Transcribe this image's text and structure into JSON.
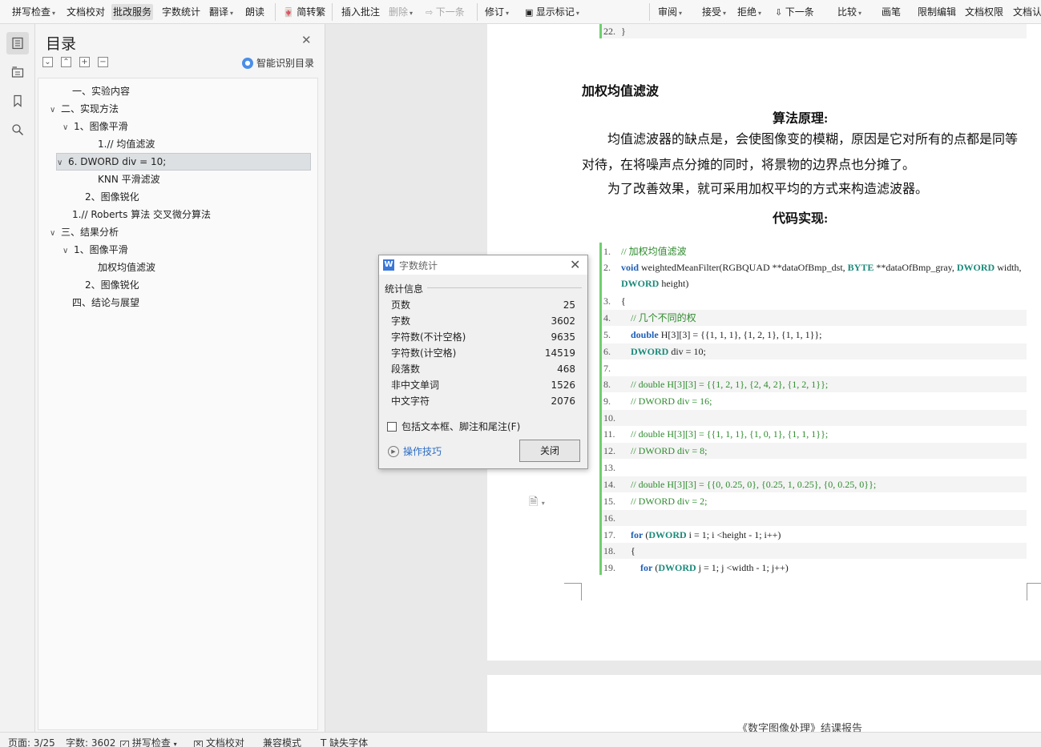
{
  "ribbon": {
    "items": [
      {
        "label": "拼写检查",
        "caret": true
      },
      {
        "label": "文档校对",
        "caret": false
      },
      {
        "label": "批改服务",
        "caret": false,
        "active": true
      },
      {
        "label": "字数统计",
        "caret": false
      },
      {
        "label": "翻译",
        "caret": true
      },
      {
        "label": "朗读",
        "caret": false
      },
      {
        "label": "简转繁",
        "caret": false
      },
      {
        "label": "插入批注",
        "caret": false
      },
      {
        "label": "删除",
        "caret": true,
        "disabled": true
      },
      {
        "label": "下一条",
        "caret": false,
        "disabled": true
      },
      {
        "label": "修订",
        "caret": true
      },
      {
        "label": "显示标记",
        "caret": true
      },
      {
        "label": "审阅",
        "caret": true
      },
      {
        "label": "接受",
        "caret": true
      },
      {
        "label": "拒绝",
        "caret": true
      },
      {
        "label": "下一条",
        "caret": false
      },
      {
        "label": "比较",
        "caret": true
      },
      {
        "label": "画笔",
        "caret": false
      },
      {
        "label": "限制编辑",
        "caret": false
      },
      {
        "label": "文档权限",
        "caret": false
      },
      {
        "label": "文档认证",
        "caret": false
      }
    ]
  },
  "iconbar": {
    "icons": [
      "toc-icon",
      "outline-icon",
      "bookmark-icon",
      "search-icon"
    ]
  },
  "toc": {
    "title": "目录",
    "smart_label": "智能识别目录",
    "items": [
      {
        "label": "一、实验内容",
        "chevron": false
      },
      {
        "label": "二、实现方法",
        "chevron": true
      },
      {
        "label": "1、图像平滑",
        "chevron": true
      },
      {
        "label": "1.// 均值滤波",
        "chevron": false
      },
      {
        "label": "6.   DWORD div = 10;",
        "chevron": true,
        "selected": true
      },
      {
        "label": "KNN 平滑滤波",
        "chevron": false
      },
      {
        "label": "2、图像锐化",
        "chevron": false
      },
      {
        "label": "1.// Roberts 算法 交叉微分算法",
        "chevron": false
      },
      {
        "label": "三、结果分析",
        "chevron": true
      },
      {
        "label": "1、图像平滑",
        "chevron": true
      },
      {
        "label": "加权均值滤波",
        "chevron": false
      },
      {
        "label": "2、图像锐化",
        "chevron": false
      },
      {
        "label": "四、结论与展望",
        "chevron": false
      }
    ]
  },
  "document": {
    "prev_code_line": {
      "num": "22.",
      "text": "}"
    },
    "heading": "加权均值滤波",
    "principle_title": "算法原理:",
    "para1": "均值滤波器的缺点是，会使图像变的模糊，原因是它对所有的点都是同等对待，在将噪声点分摊的同时，将景物的边界点也分摊了。",
    "para2": "为了改善效果，就可采用加权平均的方式来构造滤波器。",
    "code_title": "代码实现:",
    "code_lines": [
      {
        "num": "1.",
        "text": "// 加权均值滤波"
      },
      {
        "num": "2.",
        "text": "void weightedMeanFilter(RGBQUAD **dataOfBmp_dst, BYTE **dataOfBmp_gray, DWORD width,"
      },
      {
        "num": "",
        "text": "DWORD height)"
      },
      {
        "num": "3.",
        "text": "{"
      },
      {
        "num": "4.",
        "text": "// 几个不同的权"
      },
      {
        "num": "5.",
        "text": "double H[3][3] = {{1, 1, 1}, {1, 2, 1}, {1, 1, 1}};"
      },
      {
        "num": "6.",
        "text": "DWORD div = 10;"
      },
      {
        "num": "7.",
        "text": ""
      },
      {
        "num": "8.",
        "text": "// double H[3][3] = {{1, 2, 1}, {2, 4, 2}, {1, 2, 1}};"
      },
      {
        "num": "9.",
        "text": "// DWORD div = 16;"
      },
      {
        "num": "10.",
        "text": ""
      },
      {
        "num": "11.",
        "text": "// double H[3][3] = {{1, 1, 1}, {1, 0, 1}, {1, 1, 1}};"
      },
      {
        "num": "12.",
        "text": "// DWORD div = 8;"
      },
      {
        "num": "13.",
        "text": ""
      },
      {
        "num": "14.",
        "text": "// double H[3][3] = {{0, 0.25, 0}, {0.25, 1, 0.25}, {0, 0.25, 0}};"
      },
      {
        "num": "15.",
        "text": "// DWORD div = 2;"
      },
      {
        "num": "16.",
        "text": ""
      },
      {
        "num": "17.",
        "text": "for (DWORD i = 1; i <height - 1; i++)"
      },
      {
        "num": "18.",
        "text": "{"
      },
      {
        "num": "19.",
        "text": "for (DWORD j = 1; j <width - 1; j++)"
      }
    ],
    "footer_title": "《数字图像处理》结课报告"
  },
  "dialog": {
    "title": "字数统计",
    "group_label": "统计信息",
    "stats": [
      {
        "label": "页数",
        "value": "25"
      },
      {
        "label": "字数",
        "value": "3602"
      },
      {
        "label": "字符数(不计空格)",
        "value": "9635"
      },
      {
        "label": "字符数(计空格)",
        "value": "14519"
      },
      {
        "label": "段落数",
        "value": "468"
      },
      {
        "label": "非中文单词",
        "value": "1526"
      },
      {
        "label": "中文字符",
        "value": "2076"
      }
    ],
    "checkbox_label": "包括文本框、脚注和尾注(F)",
    "checkbox_checked": false,
    "tips_label": "操作技巧",
    "close_label": "关闭"
  },
  "status": {
    "page": "页面: 3/25",
    "words": "字数: 3602",
    "spell": "拼写检查",
    "proof": "文档校对",
    "compat": "兼容模式",
    "missing_font": "缺失字体"
  }
}
